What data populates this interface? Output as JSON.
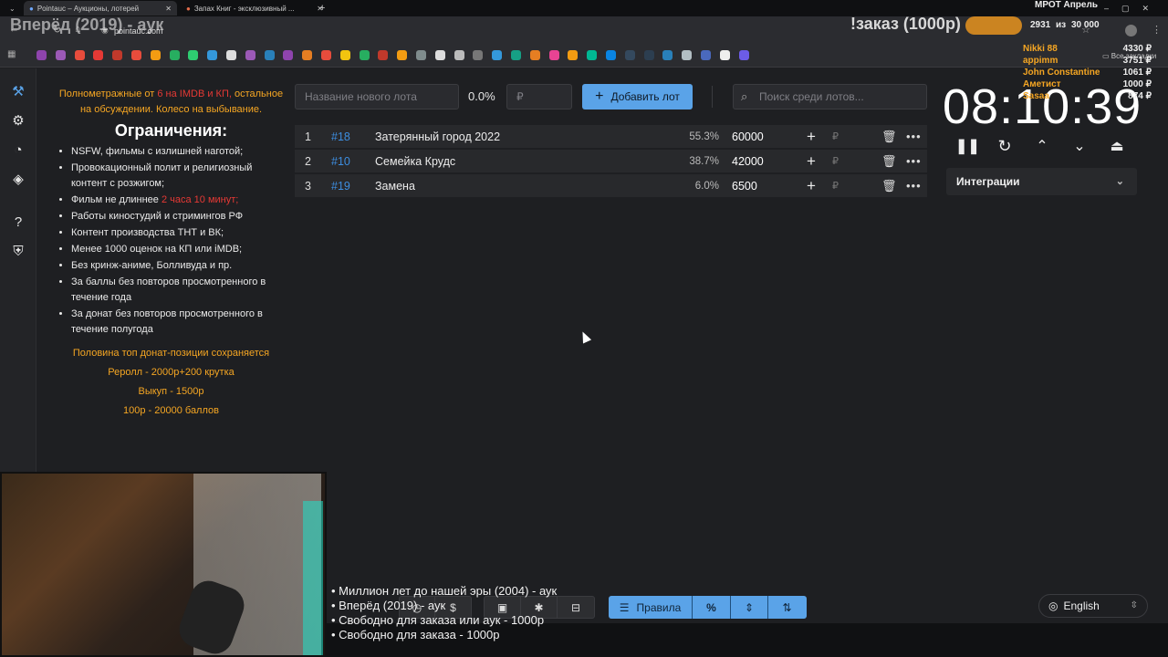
{
  "browser": {
    "tabs": [
      {
        "title": "Pointauc – Аукционы, лотерей"
      },
      {
        "title": "Запах Книг - эксклюзивный ..."
      }
    ],
    "url": "pointauc.com",
    "all_bookmarks": "Все закладки"
  },
  "stream_overlay": {
    "title": "Вперёд (2019) - аук",
    "order_banner": "!заказ (1000р)",
    "mrot_label": "МРОТ Апрель",
    "goal_current": "2931",
    "goal_sep": "из",
    "goal_target": "30 000",
    "donors": [
      {
        "name": "Nikki 88",
        "amount": "4330 ₽"
      },
      {
        "name": "appimm",
        "amount": "3751 ₽"
      },
      {
        "name": "John Constantine",
        "amount": "1061 ₽"
      },
      {
        "name": "Аметист",
        "amount": "1000 ₽"
      },
      {
        "name": "Sasaa",
        "amount": "874 ₽"
      }
    ],
    "ticker": [
      "• Миллион лет до нашей эры (2004) - аук",
      "• Вперёд (2019) - аук",
      "• Свободно для заказа или аук - 1000р",
      "• Свободно для заказа - 1000р"
    ]
  },
  "rules": {
    "intro_pre": "Полнометражные от ",
    "intro_red": "6 на IMDB и КП,",
    "intro_post": " остальное на обсуждении. Колесо на выбывание.",
    "heading": "Ограничения:",
    "items": [
      {
        "text": "NSFW, фильмы с излишней наготой;"
      },
      {
        "text": "Провокационный полит и религиозный контент с розжигом;"
      },
      {
        "text": "Фильм не длиннее ",
        "red": "2 часа 10 минут;"
      },
      {
        "text": "Работы киностудий и стримингов РФ"
      },
      {
        "text": "Контент производства ТНТ и ВК;"
      },
      {
        "text": "Менее 1000 оценок на КП или iMDB;"
      },
      {
        "text": "Без кринж-аниме, Болливуда и пр."
      },
      {
        "text": "За баллы без повторов просмотренного в течение года"
      },
      {
        "text": "За донат без повторов просмотренного в течение полугода"
      }
    ],
    "footer": [
      "Половина топ донат-позиции сохраняется",
      "Реролл - 2000р+200 крутка",
      "Выкуп - 1500р",
      "100р - 20000 баллов"
    ]
  },
  "controls": {
    "lot_name_placeholder": "Название нового лота",
    "percent": "0.0%",
    "amount_placeholder": "₽",
    "add_button": "Добавить лот",
    "search_placeholder": "Поиск среди лотов..."
  },
  "lots": [
    {
      "pos": "1",
      "id": "#18",
      "name": "Затерянный город 2022",
      "percent": "55.3%",
      "amount": "60000"
    },
    {
      "pos": "2",
      "id": "#10",
      "name": "Семейка Крудс",
      "percent": "38.7%",
      "amount": "42000"
    },
    {
      "pos": "3",
      "id": "#19",
      "name": "Замена",
      "percent": "6.0%",
      "amount": "6500"
    }
  ],
  "currency_symbol": "₽",
  "timer": {
    "value": "08:10:39"
  },
  "integrations_label": "Интеграции",
  "bottom_toolbar": {
    "rules_label": "Правила"
  },
  "language": "English",
  "colors": {
    "accent": "#5aa3e8",
    "highlight": "#f5a623",
    "warning": "#e53935",
    "background": "#1e1f22"
  }
}
